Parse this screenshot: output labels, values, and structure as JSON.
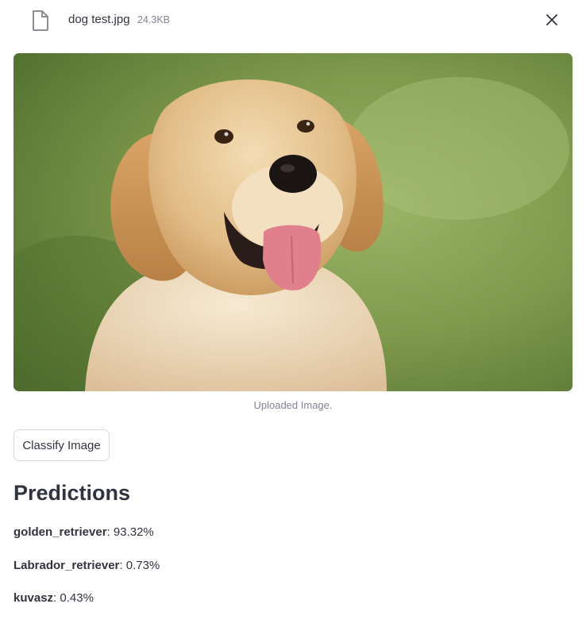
{
  "file": {
    "name": "dog test.jpg",
    "size": "24.3KB",
    "icon": "file-icon",
    "close_icon": "close-icon"
  },
  "image": {
    "caption": "Uploaded Image."
  },
  "actions": {
    "classify_label": "Classify Image"
  },
  "predictions": {
    "title": "Predictions",
    "items": [
      {
        "label": "golden_retriever",
        "value": ": 93.32%"
      },
      {
        "label": "Labrador_retriever",
        "value": ": 0.73%"
      },
      {
        "label": "kuvasz",
        "value": ": 0.43%"
      }
    ]
  }
}
